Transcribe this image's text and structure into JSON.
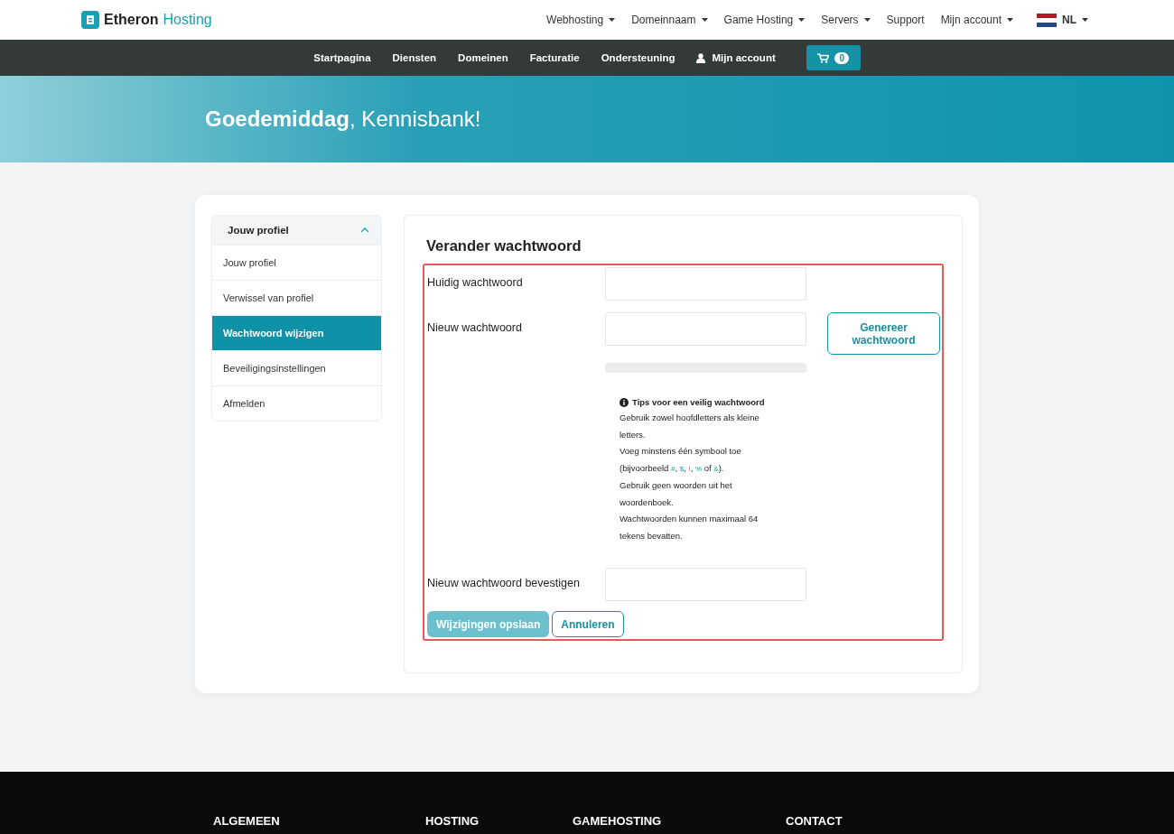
{
  "brand": {
    "name": "Etheron",
    "suffix": "Hosting"
  },
  "top_menu": [
    {
      "label": "Webhosting",
      "dropdown": true
    },
    {
      "label": "Domeinnaam",
      "dropdown": true
    },
    {
      "label": "Game Hosting",
      "dropdown": true
    },
    {
      "label": "Servers",
      "dropdown": true
    },
    {
      "label": "Support",
      "dropdown": false
    },
    {
      "label": "Mijn account",
      "dropdown": true
    }
  ],
  "language": "NL",
  "nav": [
    {
      "label": "Startpagina",
      "kind": "link"
    },
    {
      "label": "Diensten",
      "kind": "link"
    },
    {
      "label": "Domeinen",
      "kind": "link"
    },
    {
      "label": "Facturatie",
      "kind": "link"
    },
    {
      "label": "Ondersteuning",
      "kind": "link"
    },
    {
      "label": "Mijn account",
      "kind": "account"
    }
  ],
  "cart_count": "0",
  "greeting": {
    "bold": "Goedemiddag",
    "rest": ", Kennisbank!"
  },
  "sidebar": {
    "title": "Jouw profiel",
    "expanded": true,
    "items": [
      {
        "label": "Jouw profiel",
        "selected": false
      },
      {
        "label": "Verwissel van profiel",
        "selected": false
      },
      {
        "label": "Wachtwoord wijzigen",
        "selected": true
      },
      {
        "label": "Beveiligingsinstellingen",
        "selected": false
      },
      {
        "label": "Afmelden",
        "selected": false
      }
    ]
  },
  "form": {
    "title": "Verander wachtwoord",
    "current_label": "Huidig wachtwoord",
    "new_label": "Nieuw wachtwoord",
    "generate_button": "Genereer wachtwoord",
    "strength": {
      "level": 0
    },
    "tips_title": "Tips voor een veilig wachtwoord",
    "tips": [
      [
        {
          "kind": "text",
          "text": "Gebruik zowel hoofdletters als kleine letters."
        }
      ],
      [
        {
          "kind": "text",
          "text": "Voeg minstens één symbool toe (bijvoorbeeld "
        },
        {
          "kind": "code",
          "text": "#"
        },
        {
          "kind": "text",
          "text": ", "
        },
        {
          "kind": "code",
          "text": "$"
        },
        {
          "kind": "text",
          "text": ", "
        },
        {
          "kind": "code",
          "text": "!"
        },
        {
          "kind": "text",
          "text": ", "
        },
        {
          "kind": "code",
          "text": "%"
        },
        {
          "kind": "text",
          "text": " of "
        },
        {
          "kind": "code",
          "text": "&"
        },
        {
          "kind": "text",
          "text": ")."
        }
      ],
      [
        {
          "kind": "text",
          "text": "Gebruik geen woorden uit het woordenboek."
        }
      ],
      [
        {
          "kind": "text",
          "text": "Wachtwoorden kunnen maximaal 64 tekens bevatten."
        }
      ]
    ],
    "confirm_label": "Nieuw wachtwoord bevestigen",
    "save_button": "Wijzigingen opslaan",
    "cancel_button": "Annuleren"
  },
  "footer": [
    "ALGEMEEN",
    "HOSTING",
    "GAMEHOSTING",
    "CONTACT"
  ]
}
